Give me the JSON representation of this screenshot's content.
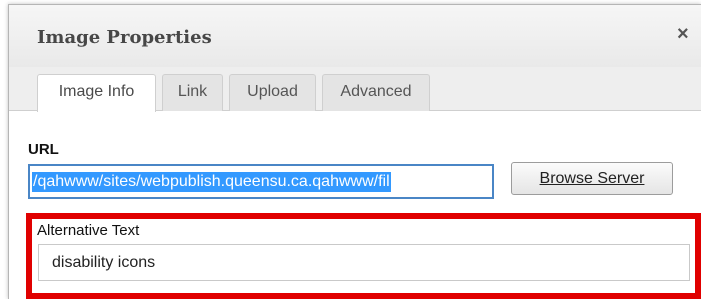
{
  "dialog": {
    "title": "Image Properties",
    "close_glyph": "×"
  },
  "tabs": [
    {
      "label": "Image Info",
      "active": true
    },
    {
      "label": "Link",
      "active": false
    },
    {
      "label": "Upload",
      "active": false
    },
    {
      "label": "Advanced",
      "active": false
    }
  ],
  "url": {
    "label": "URL",
    "value": "/qahwww/sites/webpublish.queensu.ca.qahwww/fil",
    "selection_color": "#3399ff",
    "focus_border_color": "#4a86c6"
  },
  "browse_button": {
    "label": "Browse Server"
  },
  "alternative_text": {
    "label": "Alternative Text",
    "value": "disability icons",
    "highlight_color": "#e00000"
  },
  "icons": {
    "close": "close-icon"
  }
}
